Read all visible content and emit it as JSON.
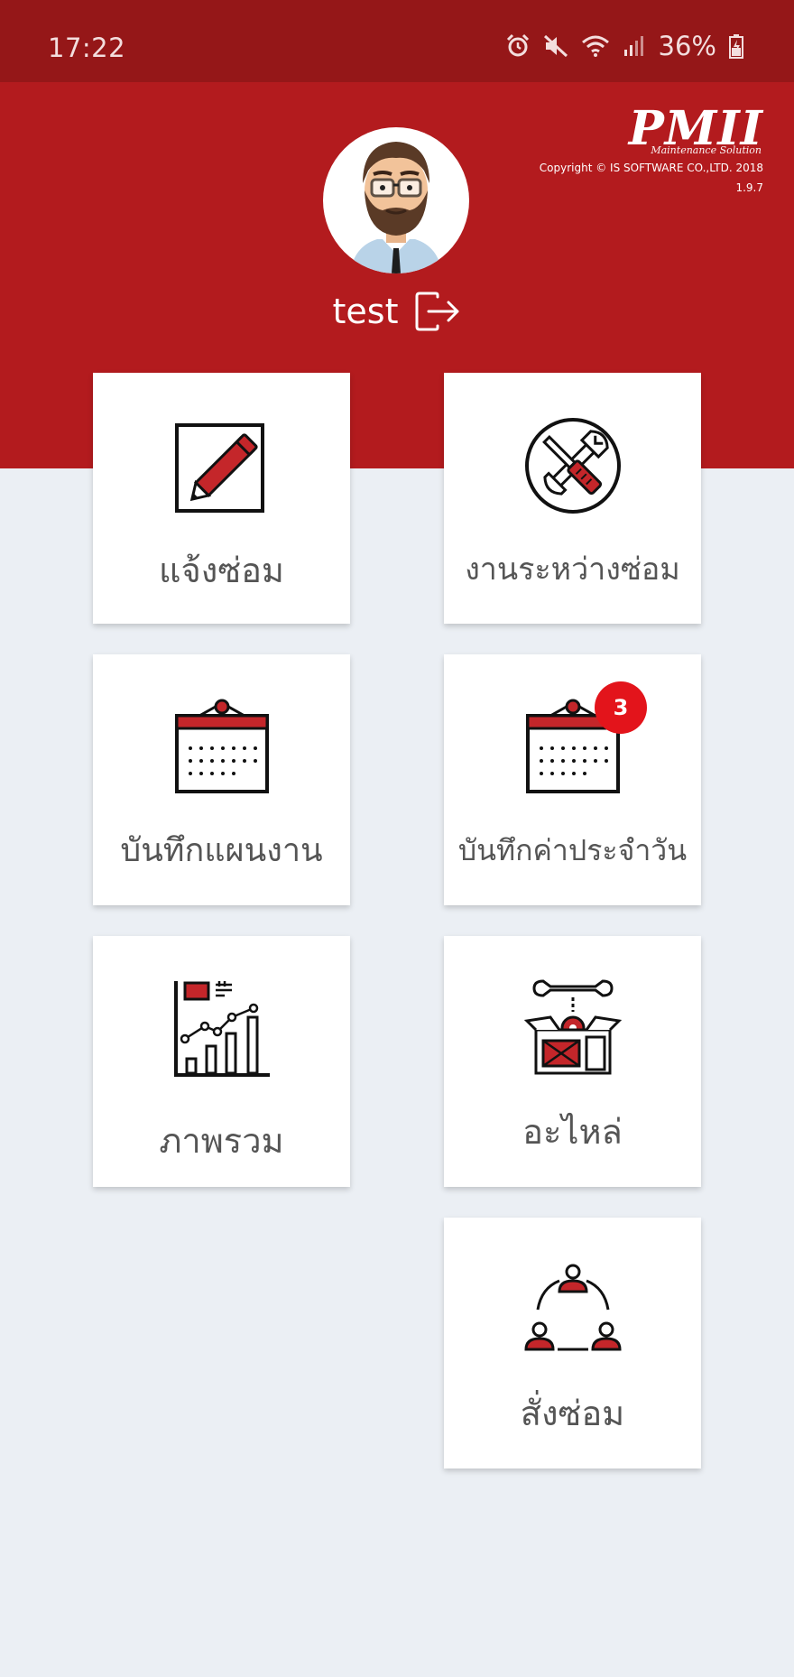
{
  "status_bar": {
    "time": "17:22",
    "battery": "36%",
    "icons": [
      "alarm-icon",
      "mute-icon",
      "wifi-icon",
      "signal-icon",
      "battery-icon"
    ]
  },
  "brand": {
    "logo": "PMII",
    "tagline": "Maintenance Solution",
    "copyright": "Copyright © IS SOFTWARE CO.,LTD. 2018",
    "version": "1.9.7"
  },
  "user": {
    "name": "test",
    "avatar": "avatar-bearded-man",
    "logout_icon": "logout-icon"
  },
  "menu": [
    {
      "label": "แจ้งซ่อม",
      "icon": "pencil-icon"
    },
    {
      "label": "งานระหว่างซ่อม",
      "icon": "tools-icon"
    },
    {
      "label": "บันทึกแผนงาน",
      "icon": "calendar-icon"
    },
    {
      "label": "บันทึกค่าประจำวัน",
      "icon": "calendar-icon",
      "badge": "3"
    },
    {
      "label": "ภาพรวม",
      "icon": "chart-icon"
    },
    {
      "label": "อะไหล่",
      "icon": "parts-box-icon"
    },
    {
      "label": "สั่งซ่อม",
      "icon": "team-icon"
    }
  ],
  "colors": {
    "status_bar": "#951718",
    "header": "#b31b1e",
    "background": "#ebeff4",
    "badge": "#e3141b",
    "icon_red": "#c4262a"
  }
}
